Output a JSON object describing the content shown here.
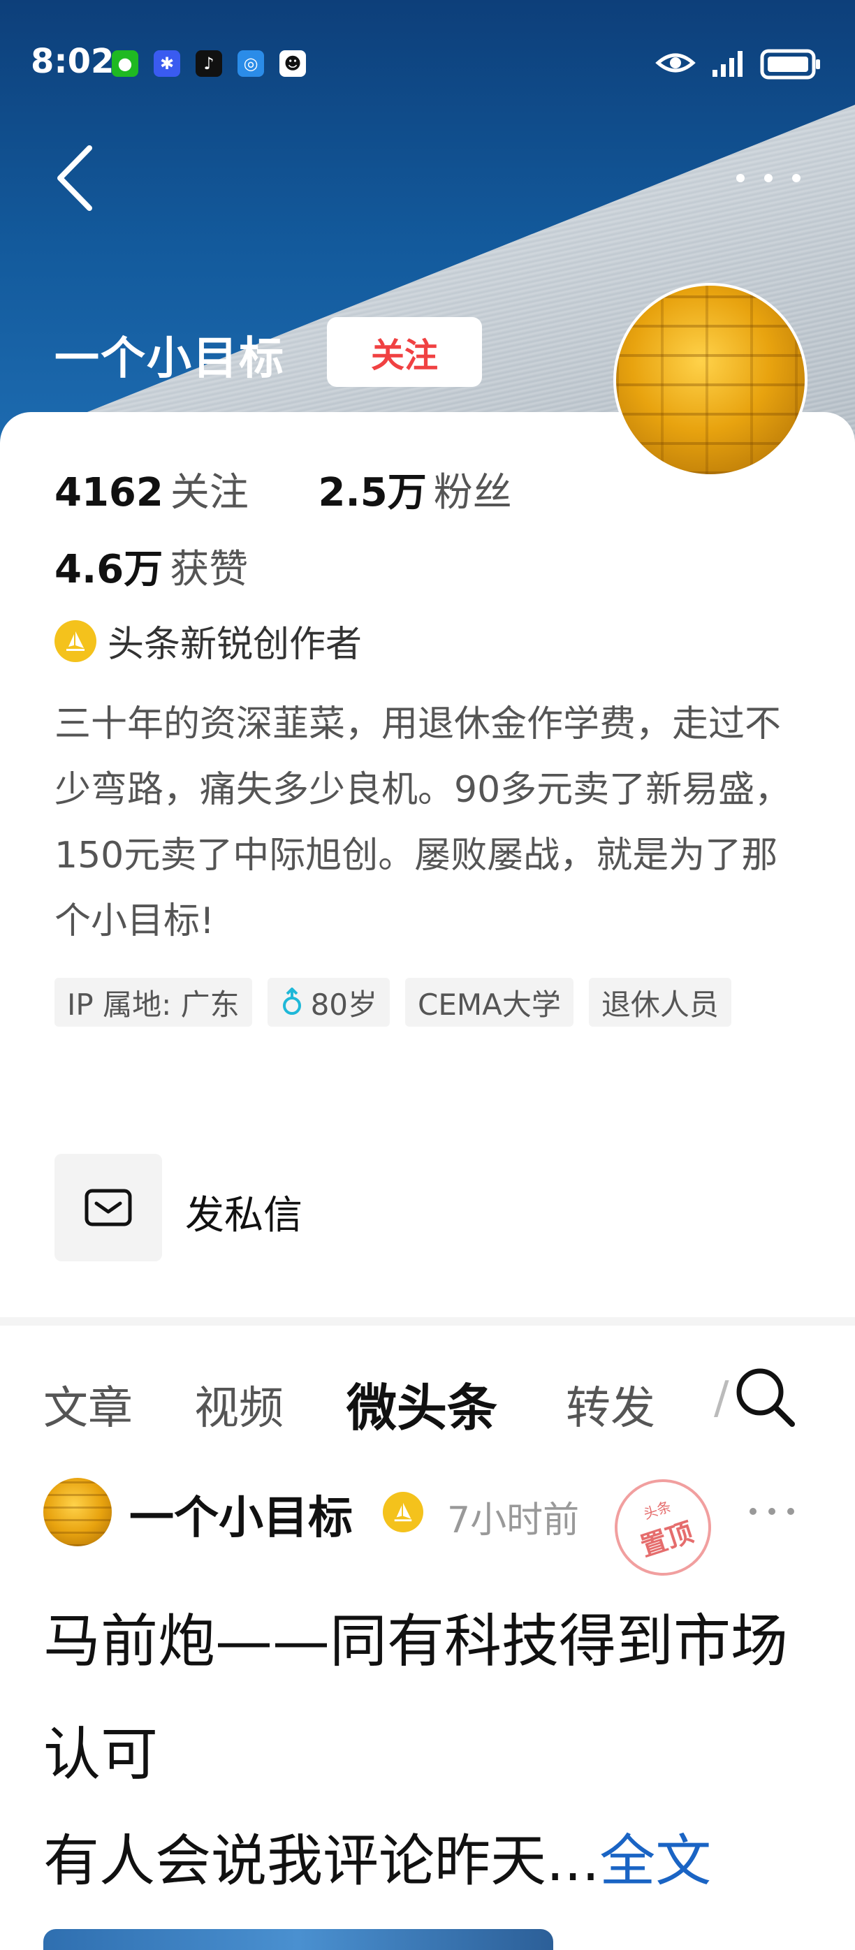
{
  "status_bar": {
    "time": "8:02",
    "app_icons": [
      "wechat-icon",
      "dingtalk-icon",
      "tiktok-icon",
      "browser-icon",
      "qq-icon"
    ],
    "right_icons": [
      "eye-icon",
      "signal-icon",
      "battery-icon"
    ]
  },
  "header": {
    "name": "一个小目标",
    "follow_label": "关注"
  },
  "stats": {
    "following_count": "4162",
    "following_label": "关注",
    "fans_count": "2.5万",
    "fans_label": "粉丝",
    "likes_count": "4.6万",
    "likes_label": "获赞"
  },
  "badge_label": "头条新锐创作者",
  "bio": "三十年的资深韮菜，用退休金作学费，走过不少弯路，痛失多少良机。90多元卖了新易盛，150元卖了中际旭创。屡败屡战，就是为了那个小目标!",
  "tags": [
    "IP 属地: 广东",
    "80岁",
    "CEMA大学",
    "退休人员"
  ],
  "message_label": "发私信",
  "tabs": [
    "文章",
    "视频",
    "微头条",
    "转发",
    "/"
  ],
  "active_tab": "微头条",
  "post": {
    "author": "一个小目标",
    "time": "7小时前",
    "stamp_top": "头条",
    "stamp_main": "置顶",
    "title": "马前炮——同有科技得到市场认可",
    "excerpt": "有人会说我评论昨天...",
    "read_more": "全文"
  },
  "colors": {
    "follow_red": "#f04142",
    "link_blue": "#1a64c4",
    "badge_gold": "#f4c21c"
  }
}
